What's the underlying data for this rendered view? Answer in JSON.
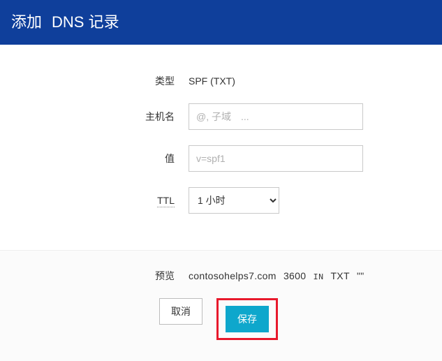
{
  "header": {
    "title_prefix": "添加",
    "title_rest": "DNS 记录"
  },
  "labels": {
    "type": "类型",
    "host": "主机名",
    "value": "值",
    "ttl": "TTL",
    "preview": "预览"
  },
  "fields": {
    "type_value": "SPF (TXT)",
    "host_placeholder": "@, 子域　...",
    "host_value": "",
    "value_placeholder": "v=spf1",
    "value_value": "",
    "ttl_selected": "1 小时"
  },
  "preview": {
    "domain": "contosohelps7.com",
    "ttl": "3600",
    "class": "IN",
    "rrtype": "TXT",
    "data": "\"\""
  },
  "buttons": {
    "cancel": "取消",
    "save": "保存"
  }
}
